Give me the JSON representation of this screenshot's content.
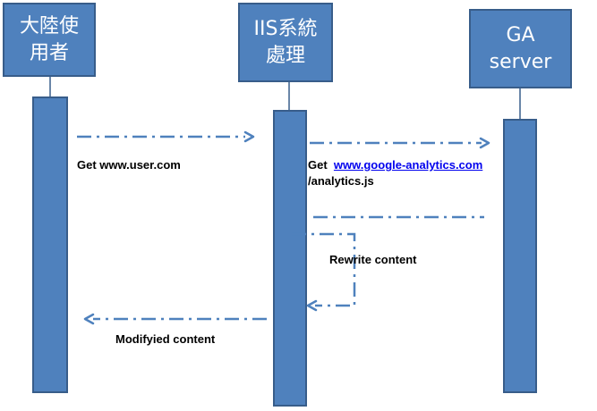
{
  "participants": {
    "user": {
      "line1": "大陸使",
      "line2": "用者"
    },
    "iis": {
      "line1": "IIS系統",
      "line2": "處理"
    },
    "ga": {
      "line1": "GA",
      "line2": "server"
    }
  },
  "messages": {
    "get_user": "Get  www.user.com",
    "get_ga_prefix": "Get  ",
    "get_ga_link": "www.google-analytics.com",
    "get_ga_path": "/analytics.js",
    "rewrite": "Rewrite content",
    "modified": "Modifyied content"
  },
  "colors": {
    "fill": "#4f81bd",
    "border": "#385d8a",
    "arrow": "#4f81bd"
  }
}
